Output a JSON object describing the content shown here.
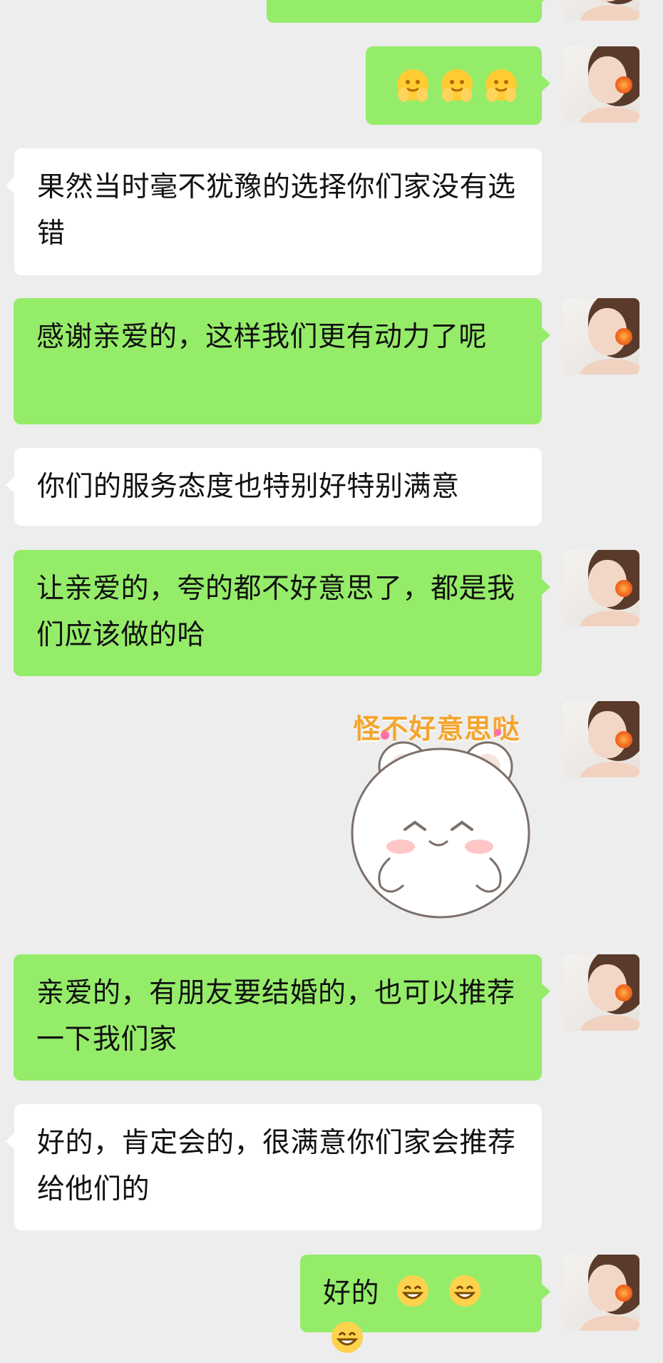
{
  "chat": {
    "colors": {
      "background": "#ededed",
      "sent_bubble": "#95ec69",
      "received_bubble": "#ffffff",
      "text": "#111111",
      "sticker_text": "#f4a52f"
    },
    "messages": [
      {
        "from": "me",
        "type": "text",
        "text": ""
      },
      {
        "from": "me",
        "type": "emoji",
        "emoji": [
          "shy-hands-icon",
          "shy-hands-icon",
          "shy-hands-icon"
        ]
      },
      {
        "from": "other",
        "type": "text",
        "text": "果然当时毫不犹豫的选择你们家没有选错"
      },
      {
        "from": "me",
        "type": "text",
        "text": "感谢亲爱的，这样我们更有动力了呢"
      },
      {
        "from": "other",
        "type": "text",
        "text": "你们的服务态度也特别好特别满意"
      },
      {
        "from": "me",
        "type": "text",
        "text": "让亲爱的，夸的都不好意思了，都是我们应该做的哈"
      },
      {
        "from": "me",
        "type": "sticker",
        "sticker": {
          "text": "怪不好意思哒",
          "icon": "shy-bear-icon"
        }
      },
      {
        "from": "me",
        "type": "text",
        "text": "亲爱的，有朋友要结婚的，也可以推荐一下我们家"
      },
      {
        "from": "other",
        "type": "text",
        "text": "好的，肯定会的，很满意你们家会推荐给他们的"
      },
      {
        "from": "me",
        "type": "text_emoji",
        "text": "好的",
        "emoji": [
          "grin-icon",
          "grin-icon",
          "grin-icon"
        ]
      }
    ]
  }
}
